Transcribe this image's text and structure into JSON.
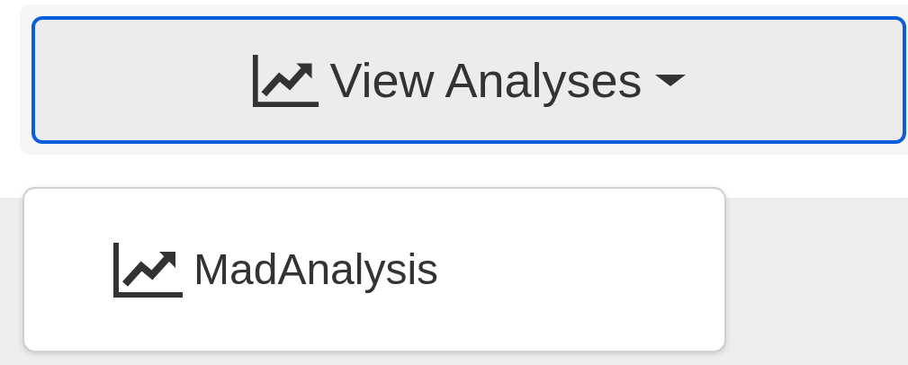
{
  "button": {
    "label": "View Analyses",
    "expanded": true
  },
  "menu": {
    "items": [
      {
        "label": "MadAnalysis"
      }
    ]
  }
}
